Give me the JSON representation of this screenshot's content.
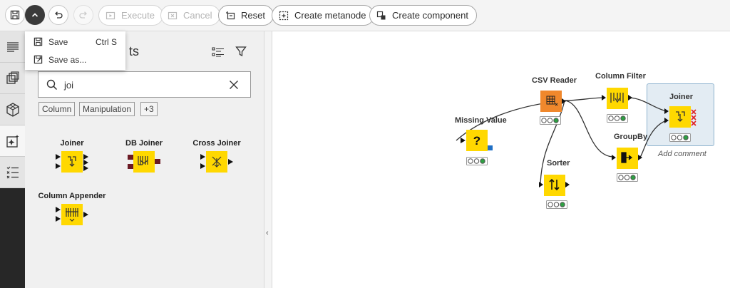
{
  "toolbar": {
    "execute_label": "Execute",
    "cancel_label": "Cancel",
    "reset_label": "Reset",
    "create_metanode_label": "Create metanode",
    "create_component_label": "Create component"
  },
  "save_menu": {
    "items": [
      {
        "label": "Save",
        "shortcut": "Ctrl S"
      },
      {
        "label": "Save as..."
      }
    ]
  },
  "panel": {
    "title_visible": "ts",
    "search": {
      "value": "joi"
    },
    "tags": [
      "Column",
      "Manipulation",
      "+3"
    ],
    "nodes": [
      {
        "label": "Joiner"
      },
      {
        "label": "DB Joiner"
      },
      {
        "label": "Cross Joiner"
      },
      {
        "label": "Column Appender"
      }
    ]
  },
  "workflow": {
    "nodes": [
      {
        "label": "CSV Reader",
        "status": "configured",
        "color": "#f0882c"
      },
      {
        "label": "Missing Value",
        "status": "configured",
        "color": "#ffd800"
      },
      {
        "label": "Column Filter",
        "status": "executed",
        "color": "#ffd800"
      },
      {
        "label": "GroupBy",
        "status": "configured",
        "color": "#ffd800"
      },
      {
        "label": "Sorter",
        "status": "executed",
        "color": "#ffd800"
      },
      {
        "label": "Joiner",
        "status": "configured",
        "color": "#ffd800"
      }
    ],
    "annotation": "Add comment"
  },
  "colors": {
    "node_yellow": "#ffd800",
    "node_orange": "#f0882c",
    "status_green": "#2ea043",
    "db_port": "#6b1a24",
    "error_red": "#e02020",
    "selection_blue": "#1f6fc5"
  }
}
